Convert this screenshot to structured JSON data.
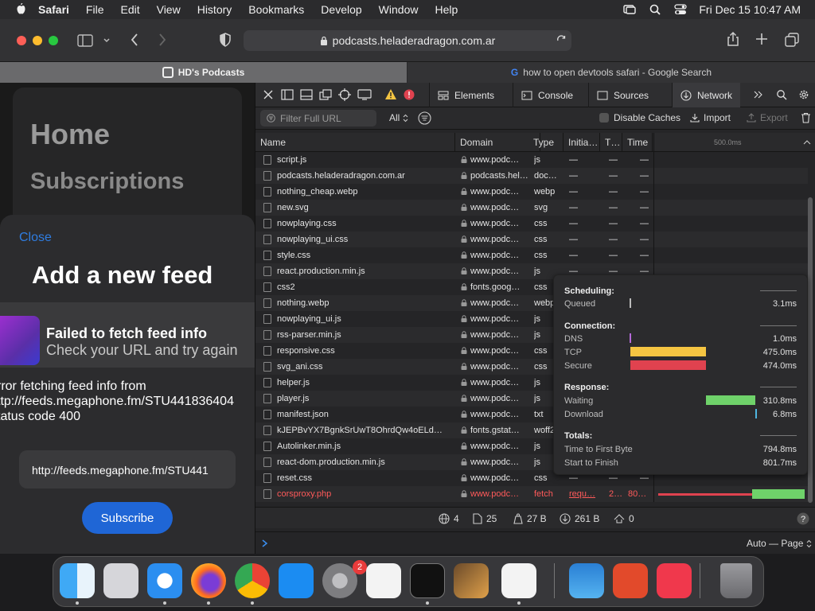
{
  "menubar": {
    "app": "Safari",
    "items": [
      "File",
      "Edit",
      "View",
      "History",
      "Bookmarks",
      "Develop",
      "Window",
      "Help"
    ],
    "datetime": "Fri Dec 15  10:47 AM"
  },
  "browser": {
    "address": "podcasts.heladeradragon.com.ar",
    "tabs": [
      {
        "title": "HD's Podcasts",
        "active": true
      },
      {
        "title": "how to open devtools safari - Google Search",
        "active": false
      }
    ]
  },
  "page": {
    "home": "Home",
    "subscriptions": "Subscriptions",
    "close": "Close",
    "heading": "Add a new feed",
    "error_title": "Failed to fetch feed info",
    "error_subtitle": "Check your URL and try again",
    "error_line1": "rror fetching feed info from",
    "error_line2": "ttp://feeds.megaphone.fm/STU441836404",
    "error_line3": "tatus code 400",
    "input_value": "http://feeds.megaphone.fm/STU441",
    "subscribe": "Subscribe"
  },
  "devtools": {
    "tabs": [
      "Elements",
      "Console",
      "Sources",
      "Network"
    ],
    "filter_placeholder": "Filter Full URL",
    "type_filter": "All",
    "disable_caches": "Disable Caches",
    "import": "Import",
    "export": "Export",
    "columns": [
      "Name",
      "Domain",
      "Type",
      "Initia…",
      "T…",
      "Time"
    ],
    "waterfall_label": "500.0ms",
    "rows": [
      {
        "name": "script.js",
        "domain": "www.podc…",
        "type": "js",
        "initiator": "—",
        "t": "—",
        "time": "—"
      },
      {
        "name": "podcasts.heladeradragon.com.ar",
        "domain": "podcasts.hel…",
        "type": "doc…",
        "initiator": "—",
        "t": "—",
        "time": "—"
      },
      {
        "name": "nothing_cheap.webp",
        "domain": "www.podc…",
        "type": "webp",
        "initiator": "—",
        "t": "—",
        "time": "—"
      },
      {
        "name": "new.svg",
        "domain": "www.podc…",
        "type": "svg",
        "initiator": "—",
        "t": "—",
        "time": "—"
      },
      {
        "name": "nowplaying.css",
        "domain": "www.podc…",
        "type": "css",
        "initiator": "—",
        "t": "—",
        "time": "—"
      },
      {
        "name": "nowplaying_ui.css",
        "domain": "www.podc…",
        "type": "css",
        "initiator": "—",
        "t": "—",
        "time": "—"
      },
      {
        "name": "style.css",
        "domain": "www.podc…",
        "type": "css",
        "initiator": "—",
        "t": "—",
        "time": "—"
      },
      {
        "name": "react.production.min.js",
        "domain": "www.podc…",
        "type": "js",
        "initiator": "—",
        "t": "—",
        "time": "—"
      },
      {
        "name": "css2",
        "domain": "fonts.goog…",
        "type": "css",
        "initiator": "",
        "t": "",
        "time": ""
      },
      {
        "name": "nothing.webp",
        "domain": "www.podc…",
        "type": "webp",
        "initiator": "",
        "t": "",
        "time": ""
      },
      {
        "name": "nowplaying_ui.js",
        "domain": "www.podc…",
        "type": "js",
        "initiator": "",
        "t": "",
        "time": ""
      },
      {
        "name": "rss-parser.min.js",
        "domain": "www.podc…",
        "type": "js",
        "initiator": "",
        "t": "",
        "time": ""
      },
      {
        "name": "responsive.css",
        "domain": "www.podc…",
        "type": "css",
        "initiator": "",
        "t": "",
        "time": ""
      },
      {
        "name": "svg_ani.css",
        "domain": "www.podc…",
        "type": "css",
        "initiator": "",
        "t": "",
        "time": ""
      },
      {
        "name": "helper.js",
        "domain": "www.podc…",
        "type": "js",
        "initiator": "",
        "t": "",
        "time": ""
      },
      {
        "name": "player.js",
        "domain": "www.podc…",
        "type": "js",
        "initiator": "",
        "t": "",
        "time": ""
      },
      {
        "name": "manifest.json",
        "domain": "www.podc…",
        "type": "txt",
        "initiator": "",
        "t": "",
        "time": ""
      },
      {
        "name": "kJEPBvYX7BgnkSrUwT8OhrdQw4oELd…",
        "domain": "fonts.gstat…",
        "type": "woff2",
        "initiator": "",
        "t": "",
        "time": ""
      },
      {
        "name": "Autolinker.min.js",
        "domain": "www.podc…",
        "type": "js",
        "initiator": "",
        "t": "",
        "time": ""
      },
      {
        "name": "react-dom.production.min.js",
        "domain": "www.podc…",
        "type": "js",
        "initiator": "",
        "t": "",
        "time": ""
      },
      {
        "name": "reset.css",
        "domain": "www.podc…",
        "type": "css",
        "initiator": "—",
        "t": "—",
        "time": "—"
      },
      {
        "name": "corsproxy.php",
        "domain": "www.podc…",
        "type": "fetch",
        "initiator": "requ…",
        "t": "2…",
        "time": "80…"
      }
    ],
    "timing": {
      "scheduling": "Scheduling:",
      "queued": {
        "label": "Queued",
        "value": "3.1ms"
      },
      "connection": "Connection:",
      "dns": {
        "label": "DNS",
        "value": "1.0ms"
      },
      "tcp": {
        "label": "TCP",
        "value": "475.0ms"
      },
      "secure": {
        "label": "Secure",
        "value": "474.0ms"
      },
      "response": "Response:",
      "waiting": {
        "label": "Waiting",
        "value": "310.8ms"
      },
      "download": {
        "label": "Download",
        "value": "6.8ms"
      },
      "totals": "Totals:",
      "ttfb": {
        "label": "Time to First Byte",
        "value": "794.8ms"
      },
      "stf": {
        "label": "Start to Finish",
        "value": "801.7ms"
      }
    },
    "status": {
      "requests": "4",
      "resources": "25",
      "transferred": "27 B",
      "size": "261 B",
      "time": "0"
    },
    "console_mode": "Auto — Page"
  },
  "dock": {
    "badge": "2"
  },
  "colors": {
    "accent": "#1f66d6",
    "tcp": "#f5c542",
    "secure": "#e0424f",
    "waiting": "#6fd26a",
    "error": "#ff5a5a"
  }
}
